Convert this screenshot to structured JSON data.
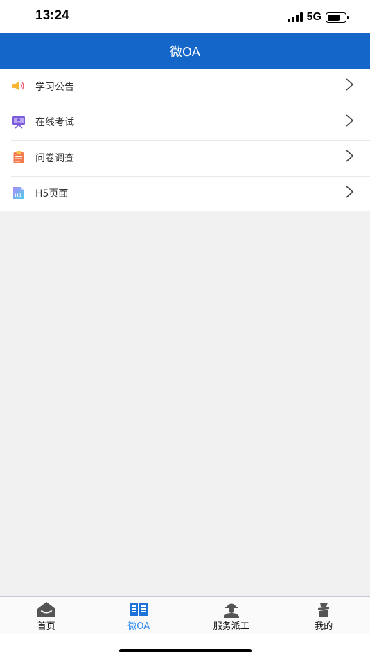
{
  "status_bar": {
    "time": "13:24",
    "network": "5G",
    "battery_level": 0.7
  },
  "header": {
    "title": "微OA"
  },
  "menu": {
    "items": [
      {
        "label": "学习公告",
        "icon": "megaphone-icon"
      },
      {
        "label": "在线考试",
        "icon": "exam-monitor-icon"
      },
      {
        "label": "问卷调查",
        "icon": "questionnaire-clipboard-icon"
      },
      {
        "label": "H5页面",
        "icon": "h5-file-icon",
        "icon_text": "H5"
      }
    ]
  },
  "tab_bar": {
    "active": "微OA",
    "tabs": [
      {
        "label": "首页",
        "icon": "home-icon"
      },
      {
        "label": "微OA",
        "icon": "oa-book-icon"
      },
      {
        "label": "服务派工",
        "icon": "worker-icon"
      },
      {
        "label": "我的",
        "icon": "profile-icon"
      }
    ]
  },
  "colors": {
    "primary": "#1467c9",
    "tab_active": "#2a8af0",
    "background": "#f1f1f1"
  }
}
